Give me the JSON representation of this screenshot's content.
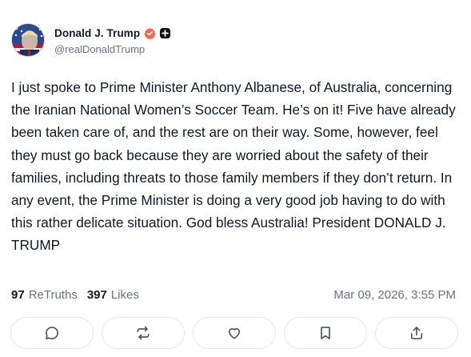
{
  "author": {
    "display_name": "Donald J. Trump",
    "handle": "@realDonaldTrump",
    "avatar_icon": "flag-portrait-avatar",
    "verified_icon": "verified-badge-icon",
    "verified_color": "#ef6c55",
    "extra_icon": "plus-square-icon"
  },
  "post": {
    "text": "I just spoke to Prime Minister Anthony Albanese, of Australia, concerning the Iranian National Women’s Soccer Team. He’s on it! Five have already been taken care of, and the rest are on their way. Some, however, feel they must go back because they are worried about the safety of their families, including threats to those family members if they don’t return. In any event, the Prime Minister is doing a very good job having to do with this rather delicate situation. God bless Australia! President DONALD J. TRUMP"
  },
  "stats": {
    "retruths_count": "97",
    "retruths_label": "ReTruths",
    "likes_count": "397",
    "likes_label": "Likes",
    "timestamp": "Mar 09, 2026, 3:55 PM"
  },
  "actions": [
    {
      "name": "reply",
      "icon": "comment-icon"
    },
    {
      "name": "retruth",
      "icon": "repost-icon"
    },
    {
      "name": "like",
      "icon": "heart-icon"
    },
    {
      "name": "bookmark",
      "icon": "bookmark-icon"
    },
    {
      "name": "share",
      "icon": "share-icon"
    }
  ]
}
